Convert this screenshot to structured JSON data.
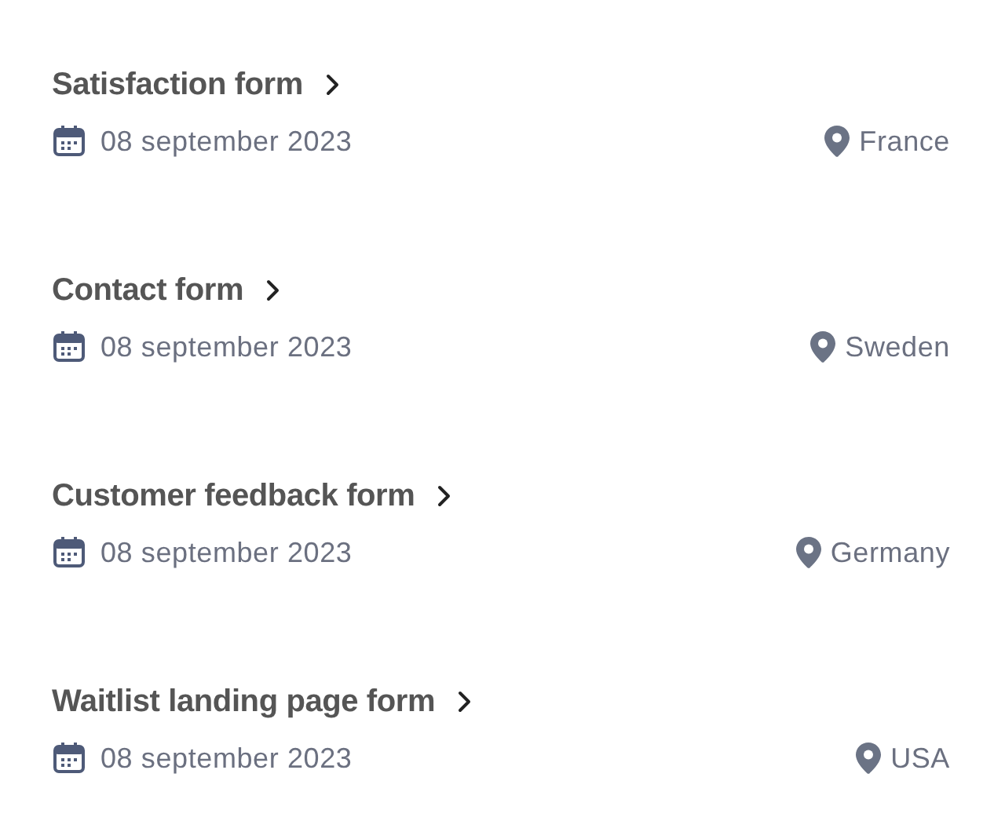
{
  "forms": [
    {
      "title": "Satisfaction form",
      "date": "08 september 2023",
      "location": "France"
    },
    {
      "title": "Contact form",
      "date": "08 september 2023",
      "location": "Sweden"
    },
    {
      "title": "Customer feedback form",
      "date": "08 september 2023",
      "location": "Germany"
    },
    {
      "title": "Waitlist landing page form",
      "date": "08 september 2023",
      "location": "USA"
    }
  ]
}
